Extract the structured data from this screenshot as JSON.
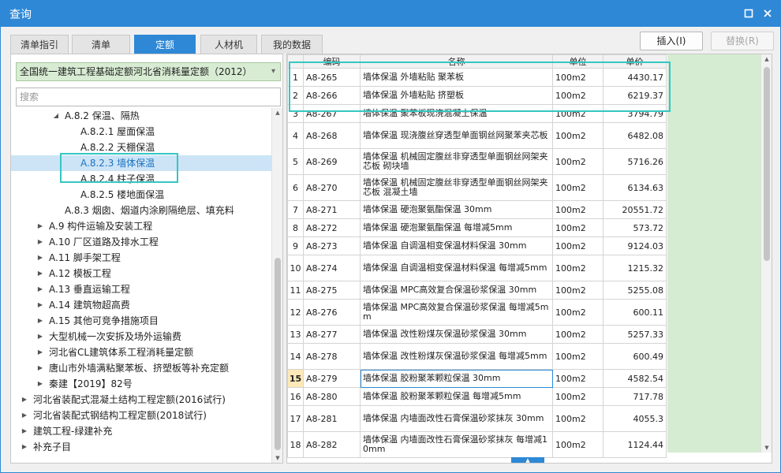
{
  "window": {
    "title": "查询",
    "restore_icon": "restore-icon",
    "close_icon": "close-icon"
  },
  "tabs": [
    {
      "label": "清单指引",
      "active": false
    },
    {
      "label": "清单",
      "active": false
    },
    {
      "label": "定额",
      "active": true
    },
    {
      "label": "人材机",
      "active": false
    },
    {
      "label": "我的数据",
      "active": false
    }
  ],
  "actions": {
    "insert_label": "插入(I)",
    "replace_label": "替换(R)"
  },
  "left": {
    "library": "全国统一建筑工程基础定额河北省消耗量定额（2012）",
    "search_placeholder": "搜索",
    "tree": [
      {
        "label": "A.8.2 保温、隔热",
        "caret": "expanded",
        "level": 2
      },
      {
        "label": "A.8.2.1 屋面保温",
        "caret": "none",
        "level": 3
      },
      {
        "label": "A.8.2.2 天棚保温",
        "caret": "none",
        "level": 3
      },
      {
        "label": "A.8.2.3 墙体保温",
        "caret": "none",
        "level": 3,
        "selected": true
      },
      {
        "label": "A.8.2.4 柱子保温",
        "caret": "none",
        "level": 3
      },
      {
        "label": "A.8.2.5 楼地面保温",
        "caret": "none",
        "level": 3
      },
      {
        "label": "A.8.3 烟囱、烟道内涂刷隔绝层、填充料",
        "caret": "none",
        "level": 2
      },
      {
        "label": "A.9 构件运输及安装工程",
        "caret": "collapsed",
        "level": 1
      },
      {
        "label": "A.10 厂区道路及排水工程",
        "caret": "collapsed",
        "level": 1
      },
      {
        "label": "A.11 脚手架工程",
        "caret": "collapsed",
        "level": 1
      },
      {
        "label": "A.12 模板工程",
        "caret": "collapsed",
        "level": 1
      },
      {
        "label": "A.13 垂直运输工程",
        "caret": "collapsed",
        "level": 1
      },
      {
        "label": "A.14 建筑物超高费",
        "caret": "collapsed",
        "level": 1
      },
      {
        "label": "A.15 其他可竞争措施项目",
        "caret": "collapsed",
        "level": 1
      },
      {
        "label": "大型机械一次安拆及场外运输费",
        "caret": "collapsed",
        "level": 1
      },
      {
        "label": "河北省CL建筑体系工程消耗量定额",
        "caret": "collapsed",
        "level": 1
      },
      {
        "label": "唐山市外墙满粘聚苯板、挤塑板等补充定额",
        "caret": "collapsed",
        "level": 1
      },
      {
        "label": "秦建【2019】82号",
        "caret": "collapsed",
        "level": 1
      },
      {
        "label": "河北省装配式混凝土结构工程定额(2016试行)",
        "caret": "collapsed",
        "level": 0
      },
      {
        "label": "河北省装配式钢结构工程定额(2018试行)",
        "caret": "collapsed",
        "level": 0
      },
      {
        "label": "建筑工程-绿建补充",
        "caret": "collapsed",
        "level": 0
      },
      {
        "label": "补充子目",
        "caret": "collapsed",
        "level": 0
      }
    ]
  },
  "grid": {
    "columns": [
      "编码",
      "名称",
      "单位",
      "单价"
    ],
    "current_row": 15,
    "rows": [
      {
        "n": "1",
        "code": "A8-265",
        "name": "墙体保温 外墙粘贴 聚苯板",
        "unit": "100m2",
        "price": "4430.17"
      },
      {
        "n": "2",
        "code": "A8-266",
        "name": "墙体保温 外墙粘贴 挤塑板",
        "unit": "100m2",
        "price": "6219.37"
      },
      {
        "n": "3",
        "code": "A8-267",
        "name": "墙体保温 聚苯板现浇混凝土保温",
        "unit": "100m2",
        "price": "3794.79"
      },
      {
        "n": "4",
        "code": "A8-268",
        "name": "墙体保温 现浇腹丝穿透型单面钢丝网聚苯夹芯板",
        "unit": "100m2",
        "price": "6482.08"
      },
      {
        "n": "5",
        "code": "A8-269",
        "name": "墙体保温 机械固定腹丝非穿透型单面钢丝网架夹芯板 砌块墙",
        "unit": "100m2",
        "price": "5716.26"
      },
      {
        "n": "6",
        "code": "A8-270",
        "name": "墙体保温 机械固定腹丝非穿透型单面钢丝网架夹芯板 混凝土墙",
        "unit": "100m2",
        "price": "6134.63"
      },
      {
        "n": "7",
        "code": "A8-271",
        "name": "墙体保温 硬泡聚氨酯保温 30mm",
        "unit": "100m2",
        "price": "20551.72"
      },
      {
        "n": "8",
        "code": "A8-272",
        "name": "墙体保温 硬泡聚氨酯保温 每增减5mm",
        "unit": "100m2",
        "price": "573.72"
      },
      {
        "n": "9",
        "code": "A8-273",
        "name": "墙体保温 自调温相变保温材料保温 30mm",
        "unit": "100m2",
        "price": "9124.03"
      },
      {
        "n": "10",
        "code": "A8-274",
        "name": "墙体保温 自调温相变保温材料保温 每增减5mm",
        "unit": "100m2",
        "price": "1215.32"
      },
      {
        "n": "11",
        "code": "A8-275",
        "name": "墙体保温 MPC高效复合保温砂浆保温 30mm",
        "unit": "100m2",
        "price": "5255.08"
      },
      {
        "n": "12",
        "code": "A8-276",
        "name": "墙体保温 MPC高效复合保温砂浆保温 每增减5mm",
        "unit": "100m2",
        "price": "600.11"
      },
      {
        "n": "13",
        "code": "A8-277",
        "name": "墙体保温 改性粉煤灰保温砂浆保温 30mm",
        "unit": "100m2",
        "price": "5257.33"
      },
      {
        "n": "14",
        "code": "A8-278",
        "name": "墙体保温 改性粉煤灰保温砂浆保温 每增减5mm",
        "unit": "100m2",
        "price": "600.49"
      },
      {
        "n": "15",
        "code": "A8-279",
        "name": "墙体保温 胶粉聚苯颗粒保温 30mm",
        "unit": "100m2",
        "price": "4582.54"
      },
      {
        "n": "16",
        "code": "A8-280",
        "name": "墙体保温 胶粉聚苯颗粒保温 每增减5mm",
        "unit": "100m2",
        "price": "717.78"
      },
      {
        "n": "17",
        "code": "A8-281",
        "name": "墙体保温 内墙面改性石膏保温砂浆抹灰 30mm",
        "unit": "100m2",
        "price": "4055.3"
      },
      {
        "n": "18",
        "code": "A8-282",
        "name": "墙体保温 内墙面改性石膏保温砂浆抹灰 每增减10mm",
        "unit": "100m2",
        "price": "1124.44"
      }
    ]
  },
  "colors": {
    "accent": "#2e88d6",
    "highlight": "#34c7c2",
    "library_bg": "#d8ecd3"
  }
}
